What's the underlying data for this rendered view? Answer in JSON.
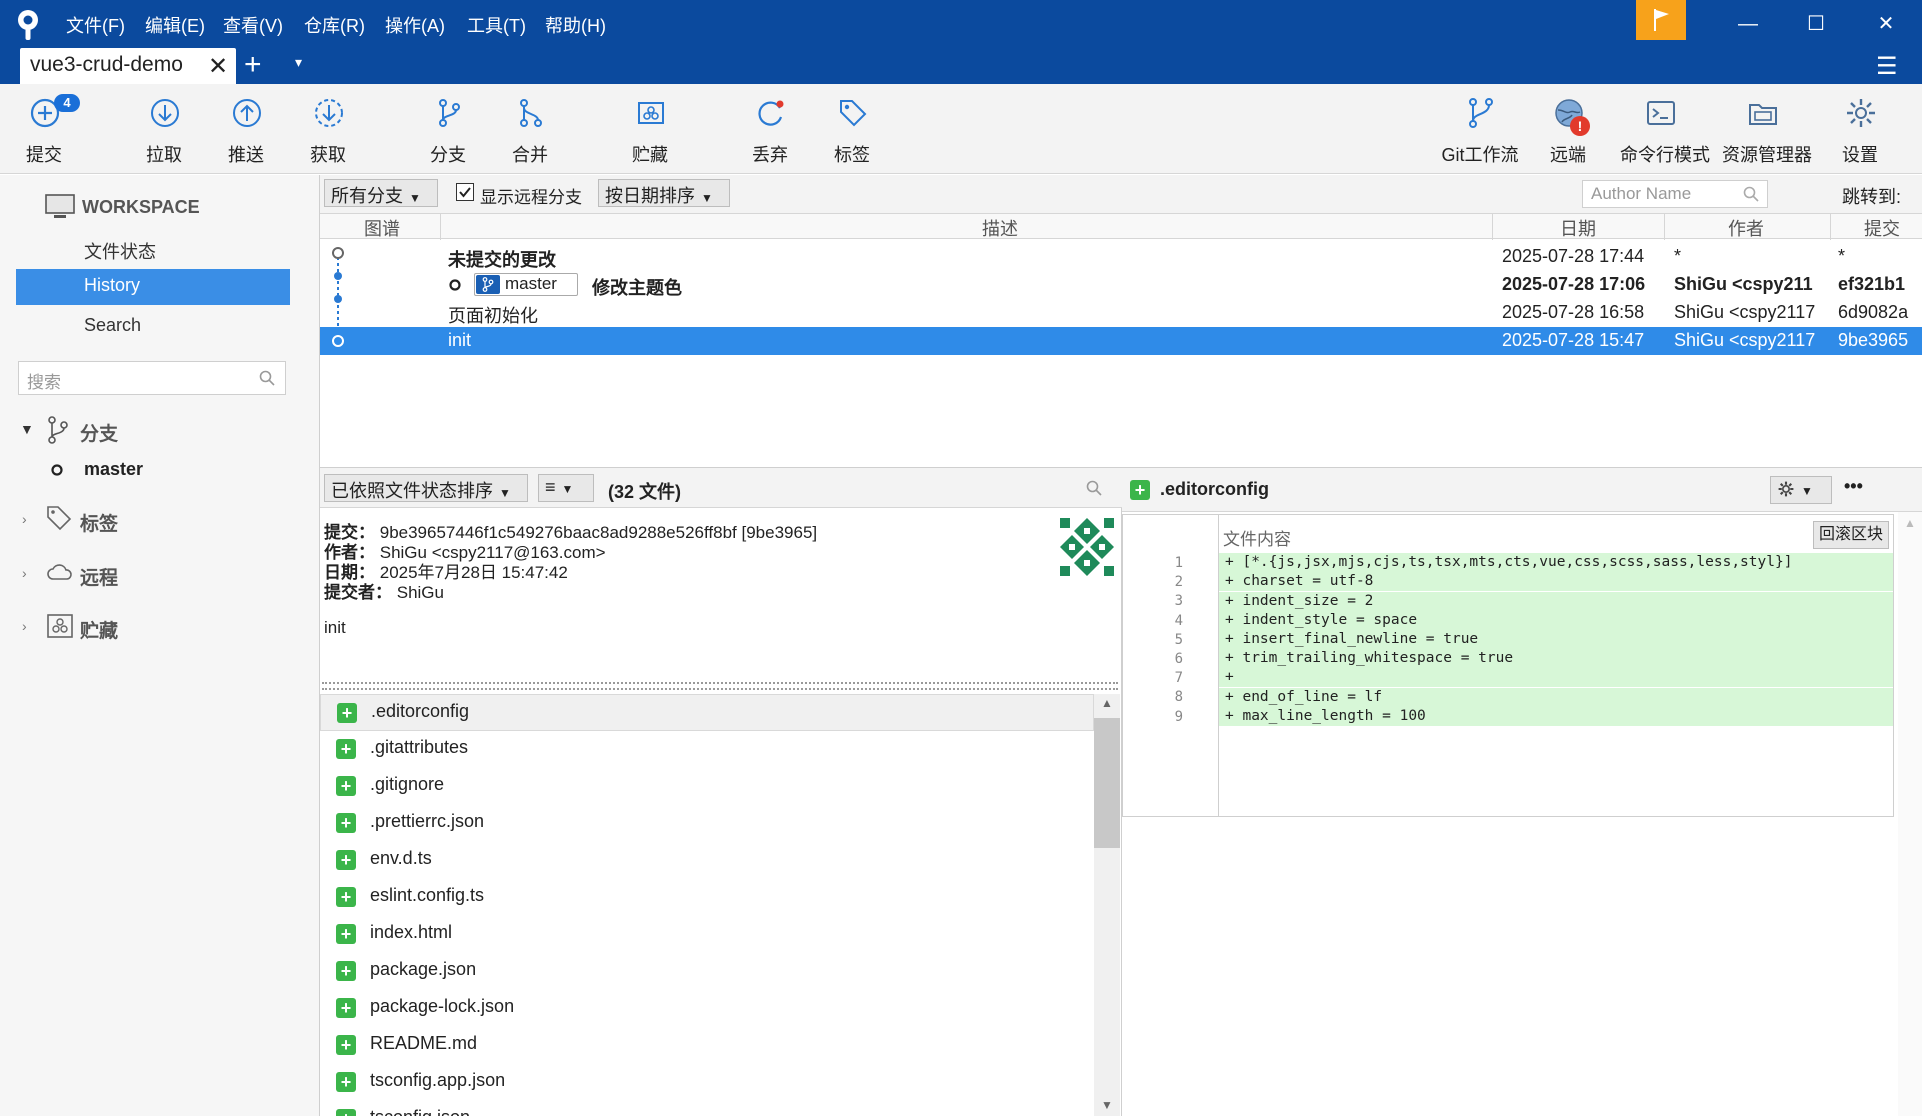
{
  "titlebar": {
    "menus": [
      "文件(F)",
      "编辑(E)",
      "查看(V)",
      "仓库(R)",
      "操作(A)",
      "工具(T)",
      "帮助(H)"
    ],
    "controls": {
      "minimize": "—",
      "maximize": "☐",
      "close": "✕"
    },
    "flag_color": "#f7a21b"
  },
  "tabs": {
    "active": "vue3-crud-demo",
    "close": "✕",
    "add": "+",
    "dropdown": "▾"
  },
  "toolbar": {
    "commit": {
      "label": "提交",
      "badge": "4"
    },
    "pull": "拉取",
    "push": "推送",
    "fetch": "获取",
    "branch": "分支",
    "merge": "合并",
    "stash": "贮藏",
    "discard": "丢弃",
    "tag": "标签",
    "gitflow": "Git工作流",
    "remote": "远端",
    "remote_alert": "!",
    "terminal": "命令行模式",
    "explorer": "资源管理器",
    "settings": "设置"
  },
  "sidebar": {
    "workspace": "WORKSPACE",
    "file_status": "文件状态",
    "history": "History",
    "search": "Search",
    "search_placeholder": "搜索",
    "branches_group": "分支",
    "current_branch": "master",
    "tags_group": "标签",
    "remotes_group": "远程",
    "stashes_group": "贮藏"
  },
  "history": {
    "branch_filter": "所有分支",
    "show_remote": "显示远程分支",
    "show_remote_checked": true,
    "sort": "按日期排序",
    "author_placeholder": "Author Name",
    "jump_to": "跳转到:",
    "columns": {
      "graph": "图谱",
      "description": "描述",
      "date": "日期",
      "author": "作者",
      "commit": "提交"
    },
    "rows": [
      {
        "description": "未提交的更改",
        "date": "2025-07-28 17:44",
        "author": "*",
        "hash": "*"
      },
      {
        "branch": "master",
        "description": "修改主题色",
        "date": "2025-07-28 17:06",
        "author": "ShiGu <cspy211",
        "hash": "ef321b1"
      },
      {
        "description": "页面初始化",
        "date": "2025-07-28 16:58",
        "author": "ShiGu <cspy2117",
        "hash": "6d9082a"
      },
      {
        "description": "init",
        "date": "2025-07-28 15:47",
        "author": "ShiGu <cspy2117",
        "hash": "9be3965"
      }
    ]
  },
  "details": {
    "sort_label": "已依照文件状态排序",
    "view_icon": "≡",
    "file_count": "(32 文件)",
    "commit_key": "提交：",
    "commit_value": "9be39657446f1c549276baac8ad9288e526ff8bf [9be3965]",
    "author_key": "作者：",
    "author_value": "ShiGu <cspy2117@163.com>",
    "date_key": "日期：",
    "date_value": "2025年7月28日 15:47:42",
    "committer_key": "提交者：",
    "committer_value": "ShiGu",
    "message": "init",
    "files": [
      ".editorconfig",
      ".gitattributes",
      ".gitignore",
      ".prettierrc.json",
      "env.d.ts",
      "eslint.config.ts",
      "index.html",
      "package.json",
      "package-lock.json",
      "README.md",
      "tsconfig.app.json",
      "tsconfig.json"
    ]
  },
  "diff": {
    "filename": ".editorconfig",
    "file_content_label": "文件内容",
    "hunk_button": "回滚区块",
    "more": "•••",
    "lines": [
      "+ [*.{js,jsx,mjs,cjs,ts,tsx,mts,cts,vue,css,scss,sass,less,styl}]",
      "+ charset = utf-8",
      "+ indent_size = 2",
      "+ indent_style = space",
      "+ insert_final_newline = true",
      "+ trim_trailing_whitespace = true",
      "+ ",
      "+ end_of_line = lf",
      "+ max_line_length = 100"
    ],
    "line_numbers": [
      "1",
      "2",
      "3",
      "4",
      "5",
      "6",
      "7",
      "8",
      "9"
    ]
  },
  "colors": {
    "accent": "#0b4a9e",
    "selection": "#2f8be8",
    "added": "#3bb54a",
    "diff_add_bg": "#d7f7d7"
  }
}
